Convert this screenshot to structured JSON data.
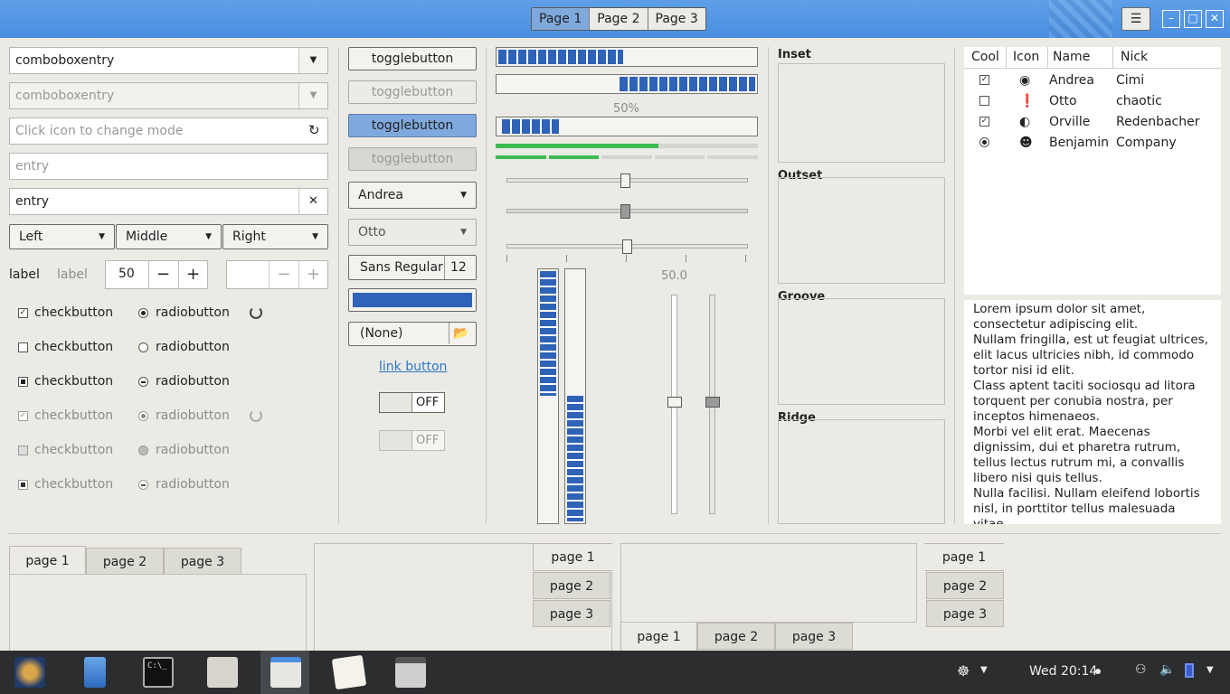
{
  "header": {
    "stack": [
      "Page 1",
      "Page 2",
      "Page 3"
    ],
    "menu_icon": "hamburger-icon"
  },
  "col1": {
    "combo1": "comboboxentry",
    "combo2": "comboboxentry",
    "entry_icon_placeholder": "Click icon to change mode",
    "entry_placeholder": "entry",
    "entry_value": "entry",
    "segmented": [
      "Left",
      "Middle",
      "Right"
    ],
    "label1": "label",
    "label2": "label",
    "spin_value": "50",
    "checks": [
      "checkbutton",
      "checkbutton",
      "checkbutton",
      "checkbutton",
      "checkbutton",
      "checkbutton"
    ],
    "radios": [
      "radiobutton",
      "radiobutton",
      "radiobutton",
      "radiobutton",
      "radiobutton",
      "radiobutton"
    ]
  },
  "col2": {
    "toggles": [
      "togglebutton",
      "togglebutton",
      "togglebutton",
      "togglebutton"
    ],
    "combo_andrea": "Andrea",
    "combo_otto": "Otto",
    "font_name": "Sans Regular",
    "font_size": "12",
    "file_none": "(None)",
    "link": "link button",
    "switch1": "OFF",
    "switch2": "OFF"
  },
  "col3": {
    "progress_text": "50%",
    "scale_value": "50.0",
    "progress1": 0.48,
    "progress2": 0.52,
    "progress3": 0.22,
    "level": 0.62
  },
  "frames": [
    "Inset",
    "Outset",
    "Groove",
    "Ridge"
  ],
  "tree": {
    "headers": [
      "Cool",
      "Icon",
      "Name",
      "Nick"
    ],
    "rows": [
      {
        "name": "Andrea",
        "nick": "Cimi"
      },
      {
        "name": "Otto",
        "nick": "chaotic"
      },
      {
        "name": "Orville",
        "nick": "Redenbacher"
      },
      {
        "name": "Benjamin",
        "nick": "Company"
      }
    ]
  },
  "text": "Lorem ipsum dolor sit amet, consectetur adipiscing elit.\nNullam fringilla, est ut feugiat ultrices, elit lacus ultricies nibh, id commodo tortor nisi id elit.\nClass aptent taciti sociosqu ad litora torquent per conubia nostra, per inceptos himenaeos.\nMorbi vel elit erat. Maecenas dignissim, dui et pharetra rutrum, tellus lectus rutrum mi, a convallis libero nisi quis tellus.\nNulla facilisi. Nullam eleifend lobortis nisl, in porttitor tellus malesuada vitae.\nAenean lacus tellus, pellentesque quis",
  "notebooks": {
    "tabs": [
      "page 1",
      "page 2",
      "page 3"
    ]
  },
  "taskbar": {
    "clock": "Wed 20:14"
  },
  "colors": {
    "accent": "#2e63b7",
    "header": "#4a8fe0",
    "green": "#3dbb4f"
  }
}
